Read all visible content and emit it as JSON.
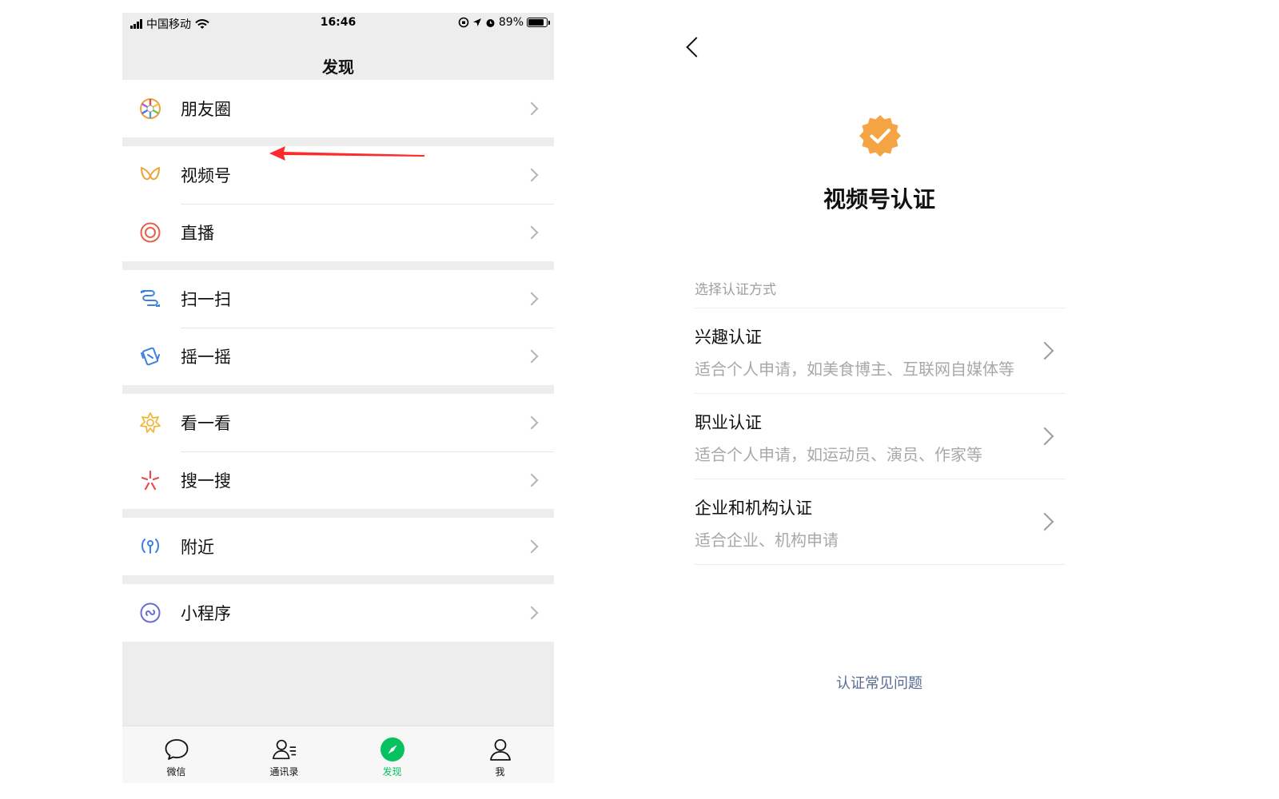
{
  "status_bar": {
    "carrier": "中国移动",
    "time": "16:46",
    "battery": "89%",
    "battery_level": 0.89
  },
  "discover": {
    "title": "发现",
    "groups": [
      {
        "items": [
          {
            "label": "朋友圈",
            "icon": "moments-icon"
          }
        ]
      },
      {
        "items": [
          {
            "label": "视频号",
            "icon": "channels-icon"
          },
          {
            "label": "直播",
            "icon": "live-icon"
          }
        ]
      },
      {
        "items": [
          {
            "label": "扫一扫",
            "icon": "scan-icon"
          },
          {
            "label": "摇一摇",
            "icon": "shake-icon"
          }
        ]
      },
      {
        "items": [
          {
            "label": "看一看",
            "icon": "top-stories-icon"
          },
          {
            "label": "搜一搜",
            "icon": "search-icon"
          }
        ]
      },
      {
        "items": [
          {
            "label": "附近",
            "icon": "nearby-icon"
          }
        ]
      },
      {
        "items": [
          {
            "label": "小程序",
            "icon": "mini-programs-icon"
          }
        ]
      }
    ],
    "tabs": [
      {
        "label": "微信",
        "icon": "chat-bubble-icon",
        "active": false
      },
      {
        "label": "通讯录",
        "icon": "contacts-icon",
        "active": false
      },
      {
        "label": "发现",
        "icon": "compass-icon",
        "active": true
      },
      {
        "label": "我",
        "icon": "person-icon",
        "active": false
      }
    ],
    "active_color": "#07c160",
    "annotation_color": "#ff2a2a"
  },
  "verification": {
    "title": "视频号认证",
    "badge_color": "#f5a444",
    "section_label": "选择认证方式",
    "options": [
      {
        "title": "兴趣认证",
        "desc": "适合个人申请，如美食博主、互联网自媒体等"
      },
      {
        "title": "职业认证",
        "desc": "适合个人申请，如运动员、演员、作家等"
      },
      {
        "title": "企业和机构认证",
        "desc": "适合企业、机构申请"
      }
    ],
    "faq": "认证常见问题",
    "link_color": "#576b95"
  }
}
